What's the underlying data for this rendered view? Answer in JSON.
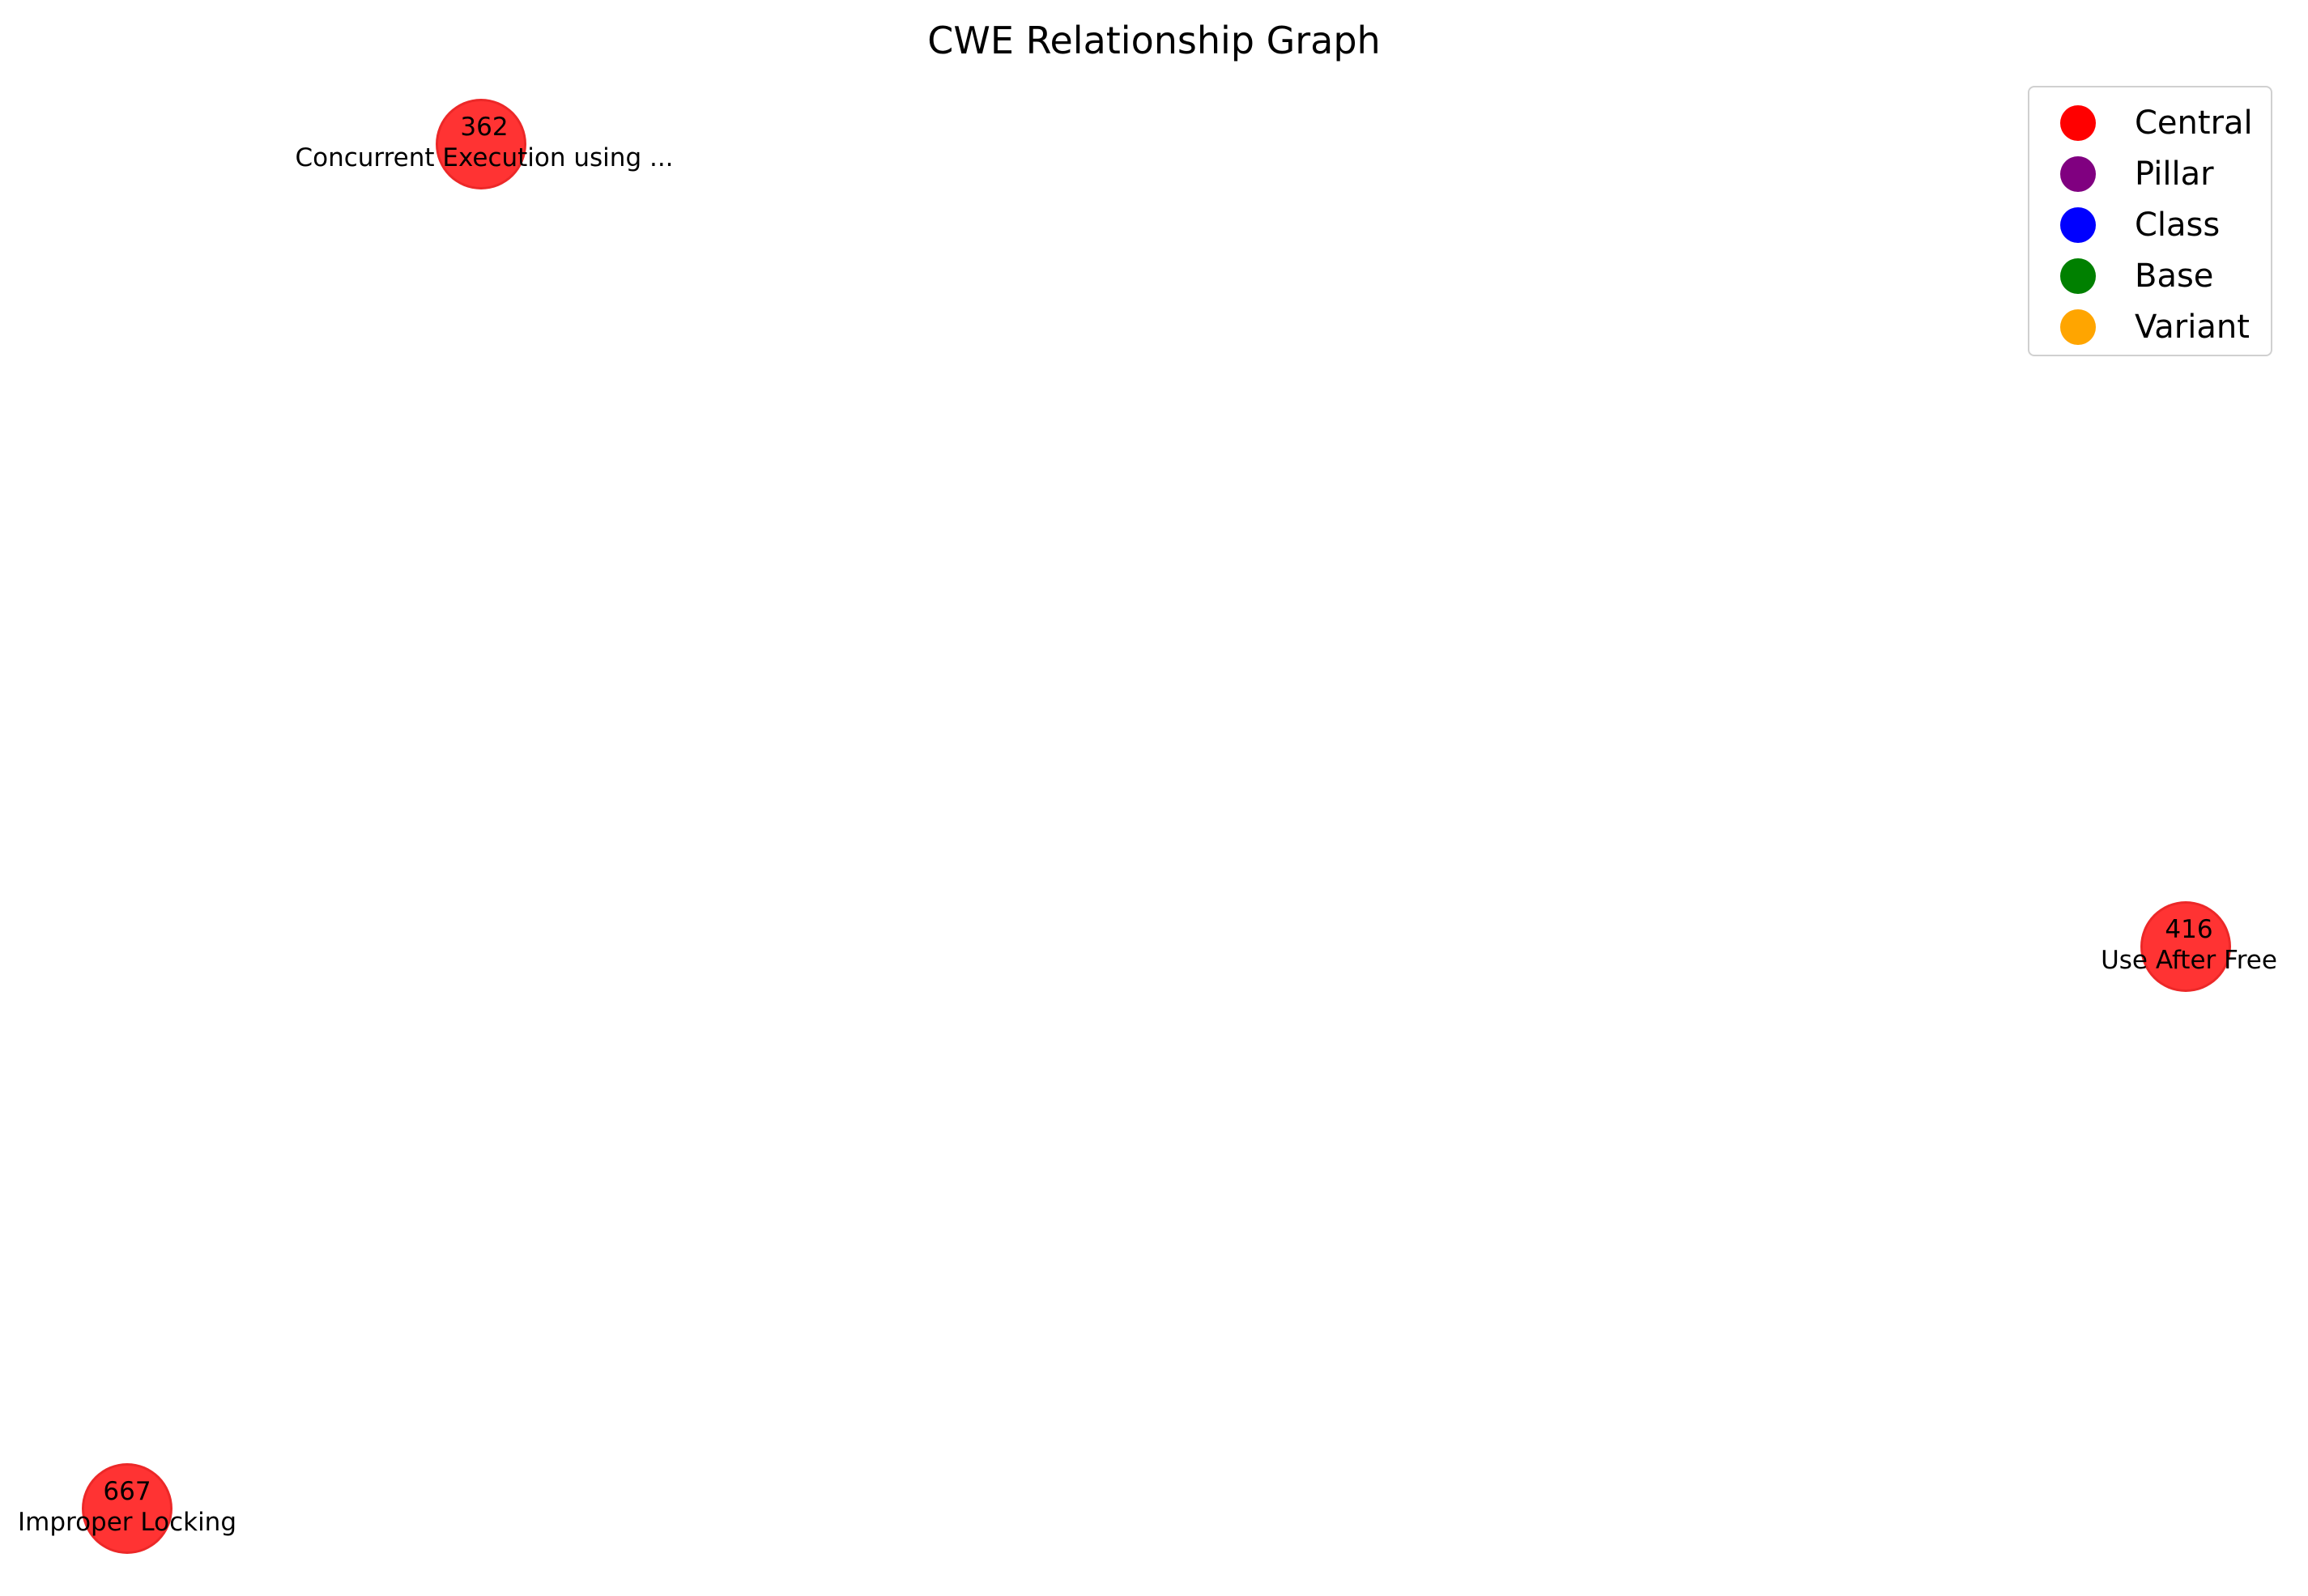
{
  "title": "CWE Relationship Graph",
  "nodes": [
    {
      "id": "362",
      "label": "Concurrent Execution using ...",
      "category": "Central"
    },
    {
      "id": "416",
      "label": "Use After Free",
      "category": "Central"
    },
    {
      "id": "667",
      "label": "Improper Locking",
      "category": "Central"
    }
  ],
  "edges": [],
  "legend": [
    {
      "label": "Central",
      "color": "#ff0000"
    },
    {
      "label": "Pillar",
      "color": "#800080"
    },
    {
      "label": "Class",
      "color": "#0000ff"
    },
    {
      "label": "Base",
      "color": "#008000"
    },
    {
      "label": "Variant",
      "color": "#ffa500"
    }
  ],
  "node_color": "#ff0000"
}
